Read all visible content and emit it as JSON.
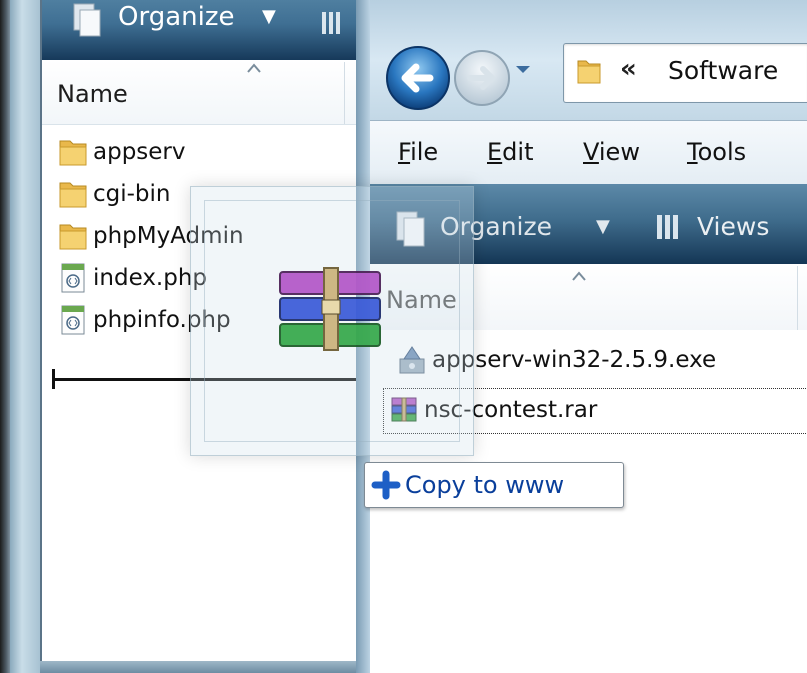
{
  "left_window": {
    "toolbar": {
      "organize_label": "Organize"
    },
    "header": {
      "name_label": "Name"
    },
    "items": [
      {
        "label": "appserv",
        "icon": "folder-icon"
      },
      {
        "label": "cgi-bin",
        "icon": "folder-icon"
      },
      {
        "label": "phpMyAdmin",
        "icon": "folder-icon"
      },
      {
        "label": "index.php",
        "icon": "php-file-icon"
      },
      {
        "label": "phpinfo.php",
        "icon": "php-file-icon"
      }
    ]
  },
  "right_window": {
    "address": {
      "chevron": "«",
      "path": "Software"
    },
    "menu": [
      {
        "accel": "F",
        "rest": "ile"
      },
      {
        "accel": "E",
        "rest": "dit"
      },
      {
        "accel": "V",
        "rest": "iew"
      },
      {
        "accel": "T",
        "rest": "ools"
      }
    ],
    "toolbar": {
      "organize_label": "Organize",
      "views_label": "Views"
    },
    "header": {
      "name_label": "Name"
    },
    "items": [
      {
        "label": "appserv-win32-2.5.9.exe",
        "icon": "installer-icon"
      },
      {
        "label": "nsc-contest.rar",
        "icon": "winrar-archive-icon",
        "focused": true
      }
    ]
  },
  "drag": {
    "tooltip_label": "Copy to www",
    "icon": "winrar-archive-icon"
  },
  "colors": {
    "toolbar_dark": "#16395a",
    "toolbar_light": "#4f7fa0",
    "tooltip_text": "#0a3f9b",
    "folder": "#e8b84a"
  }
}
